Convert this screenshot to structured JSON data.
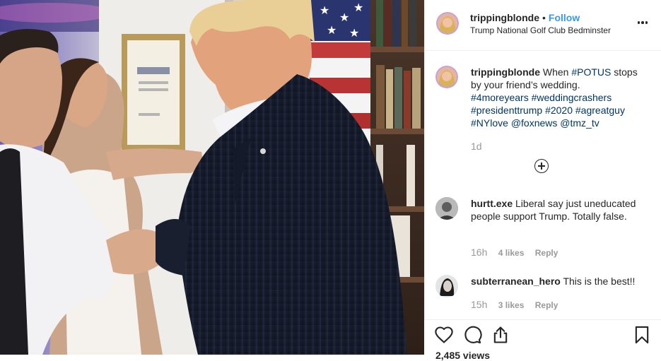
{
  "post": {
    "username": "trippingblonde",
    "separator": "•",
    "follow_label": "Follow",
    "location": "Trump National Golf Club Bedminster",
    "more_icon": "more-horizontal-icon"
  },
  "caption": {
    "username": "trippingblonde",
    "text_before": "When",
    "tag_potus": "#POTUS",
    "text_after": "stops by your friend’s wedding.",
    "tags": [
      "#4moreyears",
      "#weddingcrashers",
      "#presidenttrump",
      "#2020",
      "#agreatguy",
      "#NYlove",
      "@foxnews",
      "@tmz_tv"
    ],
    "age": "1d",
    "load_more_icon": "plus-circle-icon"
  },
  "comments": [
    {
      "username": "hurtt.exe",
      "text": "Liberal say just uneducated people support Trump. Totally false.",
      "time": "16h",
      "likes": "4 likes",
      "reply": "Reply"
    },
    {
      "username": "subterranean_hero",
      "text": "This is the best!!",
      "time": "15h",
      "likes": "3 likes",
      "reply": "Reply"
    }
  ],
  "actions": {
    "icons": [
      "heart-icon",
      "comment-icon",
      "share-icon",
      "bookmark-icon"
    ],
    "views": "2,485 views"
  },
  "colors": {
    "link_blue": "#3897f0",
    "hashtag": "#003569",
    "meta_gray": "#999999",
    "text": "#262626"
  }
}
